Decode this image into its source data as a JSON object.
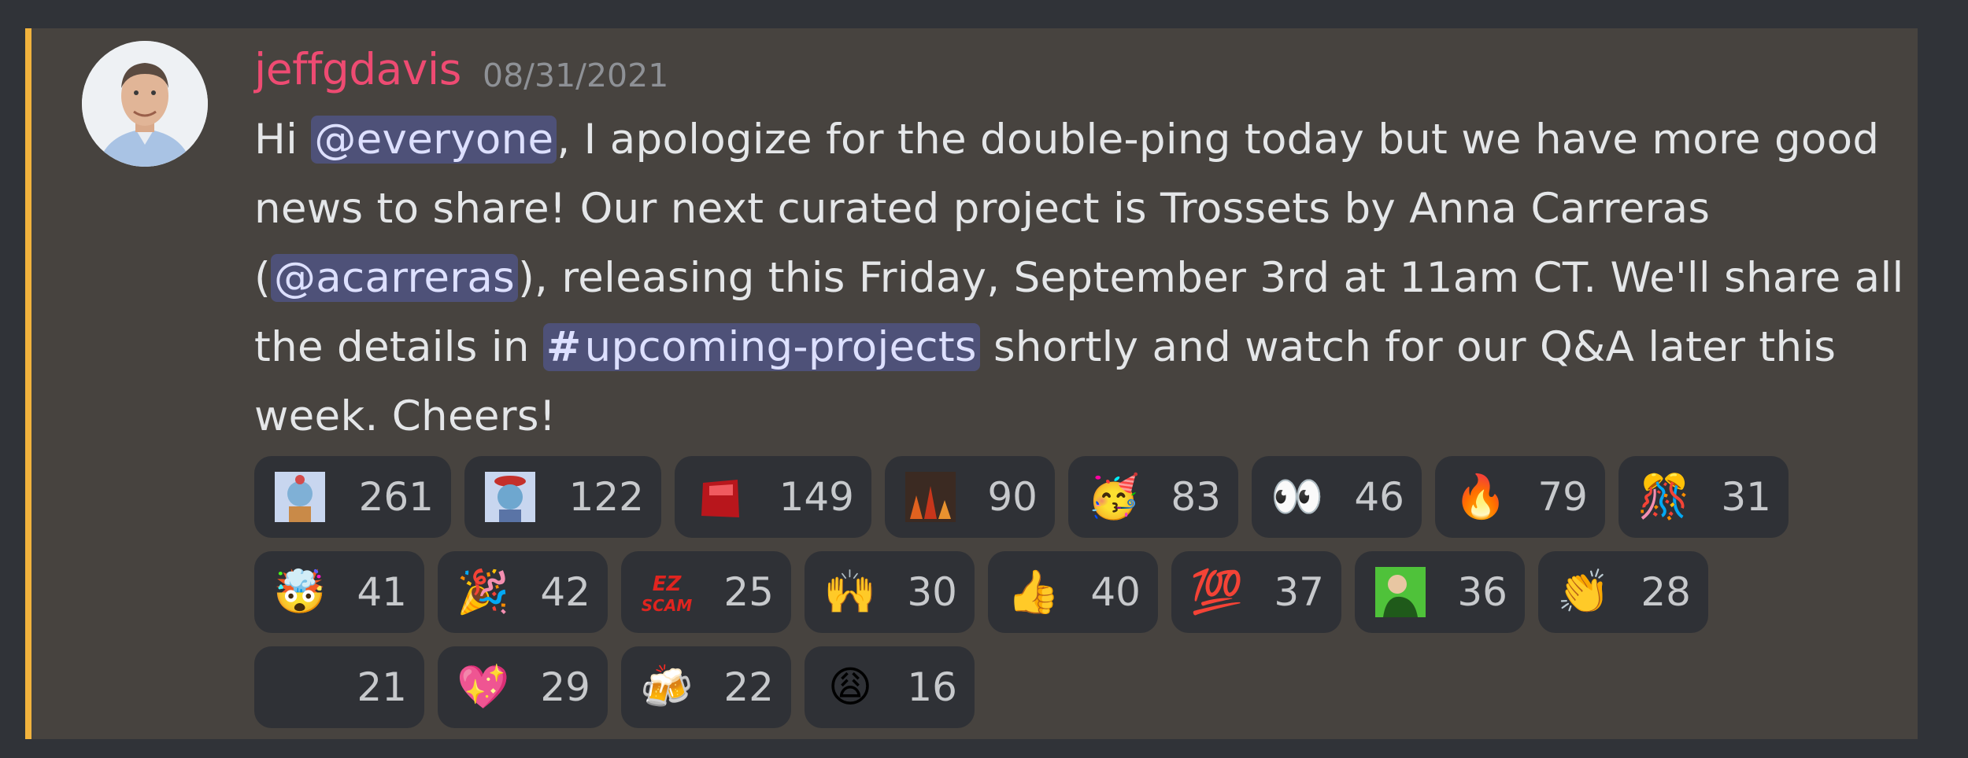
{
  "message": {
    "username": "jeffgdavis",
    "timestamp": "08/31/2021",
    "segments": {
      "s1": "Hi ",
      "m1": "@everyone",
      "s2": ", I apologize for the double-ping today but we have more good news to share! Our next curated project is Trossets by Anna Carreras (",
      "m2": "@acarreras",
      "s3": "), releasing this Friday, September 3rd at 11am CT. We'll share all the details in ",
      "channel_hash": "#",
      "m3": "upcoming-projects",
      "s4": " shortly and watch for our Q&A later this week. Cheers!"
    }
  },
  "reactions": [
    {
      "icon": "custom-ape-emoji",
      "glyph": "",
      "count": "261"
    },
    {
      "icon": "custom-ape-beret-emoji",
      "glyph": "",
      "count": "122"
    },
    {
      "icon": "custom-red-box-emoji",
      "glyph": "",
      "count": "149"
    },
    {
      "icon": "custom-pattern-emoji",
      "glyph": "",
      "count": "90"
    },
    {
      "icon": "party-face-emoji",
      "glyph": "🥳",
      "count": "83"
    },
    {
      "icon": "eyes-emoji",
      "glyph": "👀",
      "count": "46"
    },
    {
      "icon": "fire-emoji",
      "glyph": "🔥",
      "count": "79"
    },
    {
      "icon": "confetti-emoji",
      "glyph": "🎊",
      "count": "31"
    },
    {
      "icon": "exploding-head-emoji",
      "glyph": "🤯",
      "count": "41"
    },
    {
      "icon": "party-popper-emoji",
      "glyph": "🎉",
      "count": "42"
    },
    {
      "icon": "ez-scam-emoji",
      "glyph": "",
      "count": "25"
    },
    {
      "icon": "raised-hands-emoji",
      "glyph": "🙌",
      "count": "30"
    },
    {
      "icon": "thumbs-up-emoji",
      "glyph": "👍",
      "count": "40"
    },
    {
      "icon": "hundred-emoji",
      "glyph": "💯",
      "count": "37"
    },
    {
      "icon": "custom-green-character-emoji",
      "glyph": "",
      "count": "36"
    },
    {
      "icon": "clapping-hands-emoji",
      "glyph": "👏",
      "count": "28"
    },
    {
      "icon": "blank-emoji",
      "glyph": "",
      "count": "21"
    },
    {
      "icon": "sparkling-heart-emoji",
      "glyph": "💖",
      "count": "29"
    },
    {
      "icon": "clinking-beer-mugs-emoji",
      "glyph": "🍻",
      "count": "22"
    },
    {
      "icon": "weary-face-emoji",
      "glyph": "😩",
      "count": "16"
    }
  ],
  "colors": {
    "username": "#ee4b72",
    "highlight_bar": "#f1b33d",
    "mention_bg": "#4e5178"
  }
}
